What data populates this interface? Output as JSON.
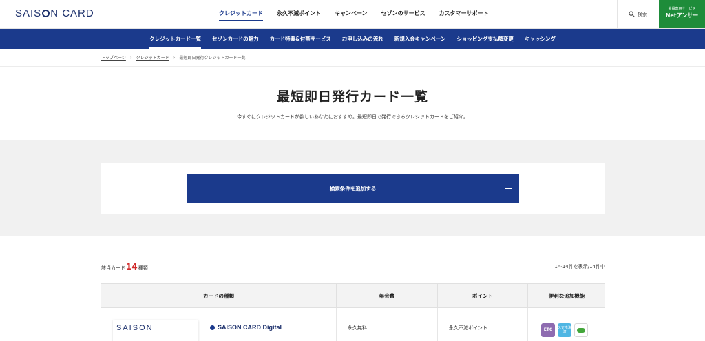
{
  "header": {
    "logo_pre": "SAIS",
    "logo_post": "N CARD",
    "nav": [
      "クレジットカード",
      "永久不滅ポイント",
      "キャンペーン",
      "セゾンのサービス",
      "カスタマーサポート"
    ],
    "search_label": "検索",
    "net_small": "会員専用サービス",
    "net_big": "Netアンサー"
  },
  "subnav": [
    "クレジットカード一覧",
    "セゾンカードの魅力",
    "カード特典&付帯サービス",
    "お申し込みの流れ",
    "新規入会キャンペーン",
    "ショッピング支払額変更",
    "キャッシング"
  ],
  "breadcrumb": {
    "top": "トップページ",
    "credit": "クレジットカード",
    "current": "最短即日発行クレジットカード一覧"
  },
  "page": {
    "title": "最短即日発行カード一覧",
    "lead": "今すぐにクレジットカードが欲しいあなたにおすすめ。最短即日で発行できるクレジットカードをご紹介。"
  },
  "search": {
    "add_condition": "検索条件を追加する"
  },
  "results": {
    "count_prefix": "該当カード",
    "count": "14",
    "count_suffix": "種類",
    "range": "1〜14件を表示/14件中"
  },
  "table": {
    "headers": [
      "カードの種類",
      "年会費",
      "ポイント",
      "便利な追加機能"
    ],
    "rows": [
      {
        "brand": "SAISON",
        "name": "SAISON CARD Digital",
        "fee": "永久無料",
        "point": "永久不滅ポイント",
        "feature_etc": "ETC",
        "feature_smart": "スマホ決済"
      }
    ]
  },
  "colors": {
    "brand_blue": "#1b3a8c",
    "net_green": "#1e8c3a",
    "count_red": "#d12b2b"
  }
}
